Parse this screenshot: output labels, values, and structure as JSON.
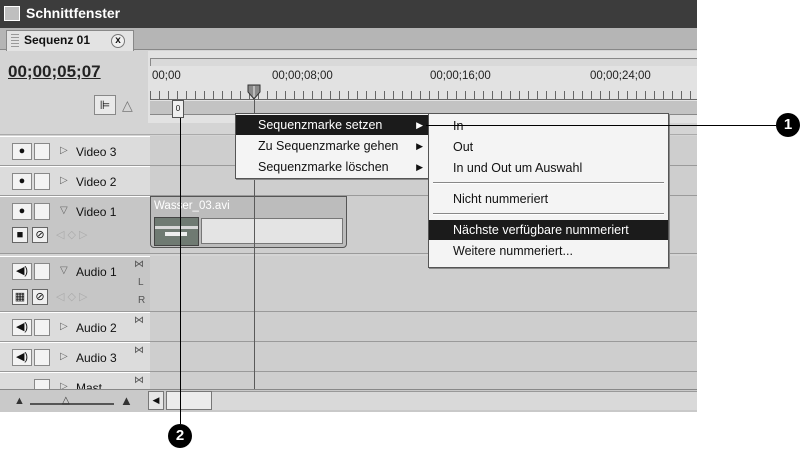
{
  "window": {
    "title": "Schnittfenster",
    "tab_label": "Sequenz 01",
    "tab_close": "x"
  },
  "timecode": "00;00;05;07",
  "ruler": {
    "labels": [
      "00;00",
      "00;00;08;00",
      "00;00;16;00",
      "00;00;24;00"
    ]
  },
  "sequence_marker_label": "0",
  "tracks": {
    "video": [
      {
        "label": "Video 3",
        "expanded": false
      },
      {
        "label": "Video 2",
        "expanded": false
      },
      {
        "label": "Video 1",
        "expanded": true
      }
    ],
    "audio": [
      {
        "label": "Audio 1",
        "expanded": true
      },
      {
        "label": "Audio 2",
        "expanded": false
      },
      {
        "label": "Audio 3",
        "expanded": false
      },
      {
        "label": "Mast",
        "expanded": false
      }
    ],
    "channel_l": "L",
    "channel_r": "R"
  },
  "clip": {
    "name": "Wasser_03.avi"
  },
  "context_menu": {
    "items": [
      {
        "label": "Sequenzmarke setzen",
        "highlighted": true
      },
      {
        "label": "Zu Sequenzmarke gehen",
        "highlighted": false
      },
      {
        "label": "Sequenzmarke löschen",
        "highlighted": false
      }
    ]
  },
  "submenu": {
    "items": [
      {
        "label": "In",
        "highlighted": false
      },
      {
        "label": "Out",
        "highlighted": false
      },
      {
        "label": "In und Out um Auswahl",
        "highlighted": false
      },
      {
        "label": "Nicht nummeriert",
        "highlighted": false
      },
      {
        "label": "Nächste verfügbare nummeriert",
        "highlighted": true
      },
      {
        "label": "Weitere nummeriert...",
        "highlighted": false
      }
    ]
  },
  "callouts": {
    "one": "1",
    "two": "2"
  },
  "colors": {
    "titlebar": "#3c3c3c",
    "highlight": "#1b1b1b",
    "panel": "#d4d4d4",
    "menu_bg": "#f4f4f4"
  }
}
